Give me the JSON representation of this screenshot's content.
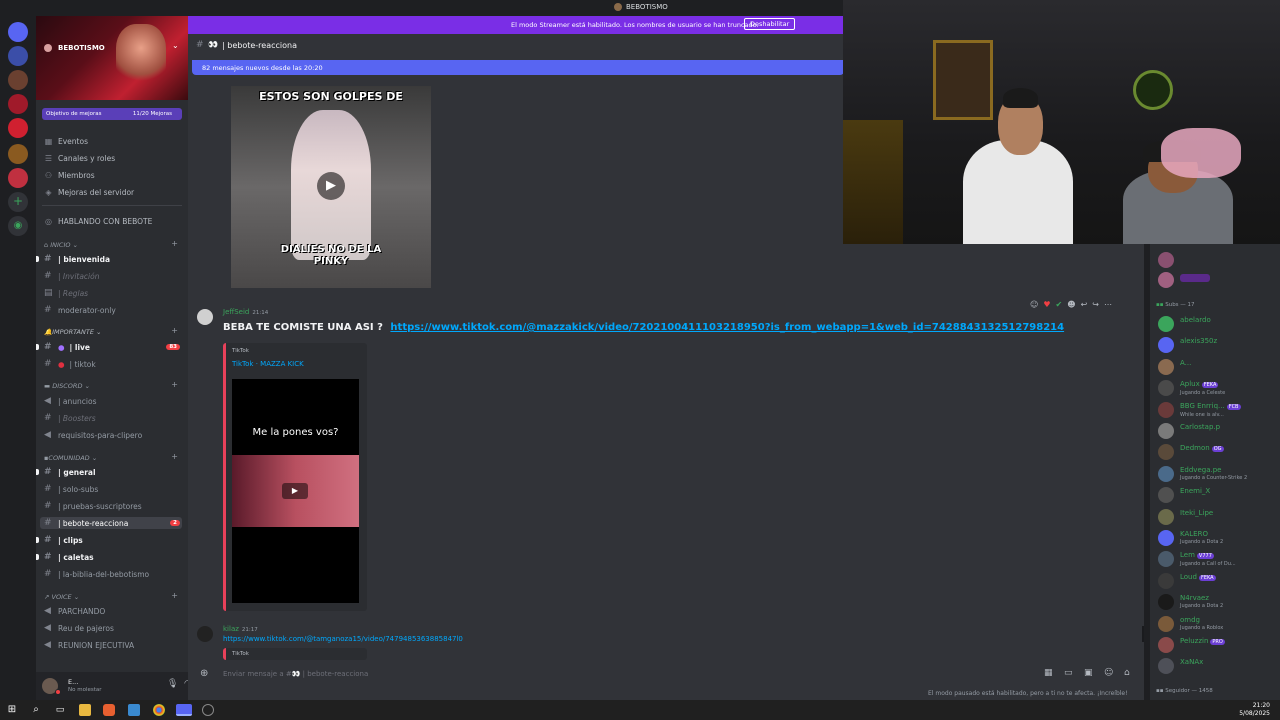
{
  "window": {
    "title": "BEBOTISMO"
  },
  "server": {
    "name": "BEBOTISMO",
    "boost_goal_label": "Objetivo de mejoras",
    "boost_progress": "11/20 Mejoras",
    "menu": [
      "Eventos",
      "Canales y roles",
      "Miembros",
      "Mejoras del servidor"
    ],
    "voice_header": "HABLANDO CON BEBOTE"
  },
  "categories": {
    "inicio": "INICIO",
    "importante": "IMPORTANTE",
    "discord": "DISCORD",
    "comunidad": "COMUNIDAD",
    "voice": "VOICE"
  },
  "channels": {
    "bienvenida": "| bienvenida",
    "invitacion": "| Invitación",
    "reglas": "| Reglas",
    "moderator": "moderator-only",
    "live": "| live",
    "live_badge": "83",
    "tiktok": "| tiktok",
    "anuncios": "| anuncios",
    "boosters": "| Boosters",
    "requisitos": "requisitos-para-clipero",
    "general": "| general",
    "solo_subs": "| solo-subs",
    "pruebas": "| pruebas-suscriptores",
    "bebote": "| bebote-reacciona",
    "bebote_badge": "2",
    "clips": "| clips",
    "caletas": "| caletas",
    "biblia": "| la-biblia-del-bebotismo",
    "voice1": "PARCHANDO",
    "voice2": "Reu de pajeros",
    "voice3": "REUNION EJECUTIVA"
  },
  "user_panel": {
    "name": "E...",
    "status": "No molestar"
  },
  "streamer_bar": {
    "text": "El modo Streamer está habilitado. Los nombres de usuario se han truncado.",
    "button": "Deshabilitar"
  },
  "channel_header": {
    "name": "| bebote-reacciona"
  },
  "new_messages": {
    "text": "82 mensajes nuevos desde las 20:20"
  },
  "image1": {
    "top_text": "ESTOS SON GOLPES DE",
    "bottom_text": "DIALIES NO DE LA PINKY"
  },
  "message1": {
    "author": "JeffSeid",
    "time": "21:14",
    "text": "BEBA TE COMISTE UNA ASI ?",
    "link": "https://www.tiktok.com/@mazzakick/video/7202100411103218950?is_from_webapp=1&web_id=7428843132512798214",
    "embed_provider": "TikTok",
    "embed_title": "TikTok · MAZZA KICK",
    "video_caption": "Me la pones vos?"
  },
  "message2": {
    "author": "kilaz",
    "time": "21:17",
    "link": "https://www.tiktok.com/@tamganoza15/video/7479485363885847l0",
    "embed_provider": "TikTok"
  },
  "composer": {
    "placeholder": "Enviar mensaje a #👀 | bebote-reacciona"
  },
  "pause_note": "El modo pausado está habilitado, pero a ti no te afecta. ¡Increíble!",
  "members": {
    "section": "Subs — 17",
    "list": [
      {
        "name": "abelardo",
        "status": ""
      },
      {
        "name": "alexis350z",
        "status": ""
      },
      {
        "name": "A...",
        "status": ""
      },
      {
        "name": "Aplux",
        "tag": "FEKA",
        "status": "Jugando a Celeste"
      },
      {
        "name": "BBG Enrriq...",
        "tag": "FCB",
        "status": "While one is alv..."
      },
      {
        "name": "Carlostap.p",
        "status": ""
      },
      {
        "name": "Dedmon",
        "tag": "OG",
        "status": ""
      },
      {
        "name": "Eddvega.pe",
        "status": "Jugando a Counter-Strike 2"
      },
      {
        "name": "Enemi_X",
        "status": ""
      },
      {
        "name": "Iteki_Lipe",
        "status": ""
      },
      {
        "name": "KALERO",
        "status": "Jugando a Dota 2"
      },
      {
        "name": "Lem",
        "tag": "V777",
        "status": "Jugando a Call of Du..."
      },
      {
        "name": "Loud",
        "tag": "FEKA",
        "status": ""
      },
      {
        "name": "N4rvaez",
        "status": "Jugando a Dota 2"
      },
      {
        "name": "omdg",
        "status": "Jugando a Roblox"
      },
      {
        "name": "Peluzzin",
        "tag": "PRO",
        "status": ""
      },
      {
        "name": "XaNAx",
        "status": ""
      }
    ],
    "footer": "Seguidor — 1458"
  },
  "clock": {
    "time": "21:20",
    "date": "5/08/2025"
  },
  "colors": {
    "accent": "#5865f2",
    "streamer": "#7a2ee6",
    "online": "#3ba55c",
    "link": "#00a8fc"
  }
}
